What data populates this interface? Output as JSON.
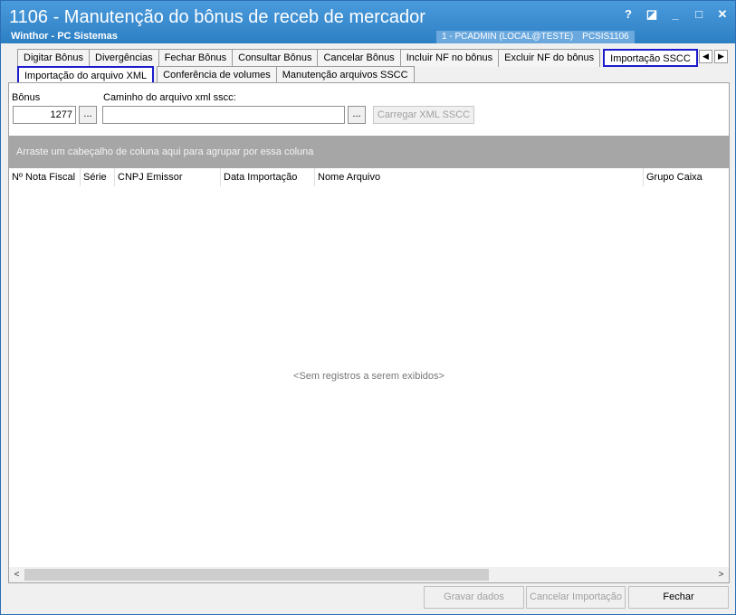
{
  "window": {
    "title": "1106 - Manutenção do bônus de receb de mercador",
    "subtitle": "Winthor - PC Sistemas",
    "info_user": "1 - PCADMIN (LOCAL@TESTE)",
    "info_routine": "PCSIS1106",
    "help": "?",
    "restore": "◪",
    "minimize": "_",
    "maximize": "□",
    "close": "✕"
  },
  "tabs": [
    {
      "label": "Digitar Bônus"
    },
    {
      "label": "Divergências"
    },
    {
      "label": "Fechar Bônus"
    },
    {
      "label": "Consultar Bônus"
    },
    {
      "label": "Cancelar Bônus"
    },
    {
      "label": "Incluir NF no bônus"
    },
    {
      "label": "Excluir NF do bônus"
    },
    {
      "label": "Importação SSCC"
    }
  ],
  "subtabs": [
    {
      "label": "Importação do arquivo XML"
    },
    {
      "label": "Conferência de volumes"
    },
    {
      "label": "Manutenção arquivos SSCC"
    }
  ],
  "form": {
    "bonus_label": "Bônus",
    "bonus_value": "1277",
    "path_label": "Caminho do arquivo xml sscc:",
    "path_value": "",
    "browse": "...",
    "load_button": "Carregar XML SSCC"
  },
  "grid": {
    "group_hint": "Arraste um cabeçalho de coluna aqui para agrupar por essa coluna",
    "columns": [
      "Nº Nota Fiscal",
      "Série",
      "CNPJ Emissor",
      "Data Importação",
      "Nome Arquivo",
      "Grupo Caixa"
    ],
    "empty_text": "<Sem registros a serem exibidos>",
    "scroll_left": "<",
    "scroll_right": ">"
  },
  "footer": {
    "save": "Gravar dados",
    "cancel_import": "Cancelar Importação",
    "close": "Fechar"
  },
  "colors": {
    "title_bar": "#2d7fc4",
    "highlight": "#1c1ccc"
  }
}
